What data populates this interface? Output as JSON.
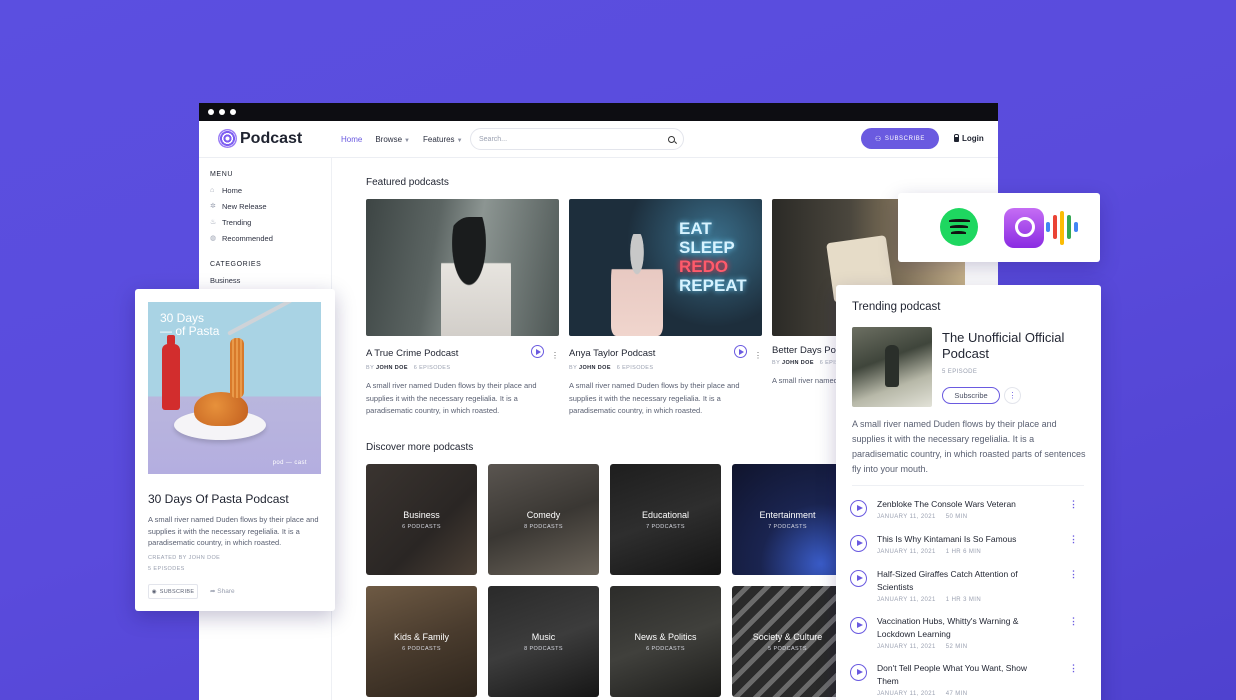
{
  "header": {
    "logo_text": "Podcast",
    "nav": [
      {
        "label": "Home"
      },
      {
        "label": "Browse"
      },
      {
        "label": "Features"
      }
    ],
    "search_placeholder": "Search...",
    "subscribe_label": "SUBSCRIBE",
    "login_label": "Login"
  },
  "sidebar": {
    "menu_heading": "MENU",
    "menu_items": [
      "Home",
      "New Release",
      "Trending",
      "Recommended"
    ],
    "categories_heading": "CATEGORIES",
    "categories": [
      "Business"
    ]
  },
  "featured": {
    "title": "Featured podcasts",
    "cards": [
      {
        "title": "A True Crime Podcast",
        "by": "BY",
        "author": "JOHN DOE",
        "episodes": "6 EPISODES",
        "desc": "A small river named Duden flows by their place and supplies it with the necessary regelialia. It is a paradisematic country, in which roasted."
      },
      {
        "title": "Anya Taylor Podcast",
        "by": "BY",
        "author": "JOHN DOE",
        "episodes": "6 EPISODES",
        "desc": "A small river named Duden flows by their place and supplies it with the necessary regelialia. It is a paradisematic country, in which roasted."
      },
      {
        "title": "Better Days Po",
        "by": "BY",
        "author": "JOHN DOE",
        "episodes": "6 EPIS",
        "desc": "A small river named Duden flows by their place and supplies it with the necessary regelialia. It is a paradisematic country, in which roasted."
      }
    ]
  },
  "discover": {
    "title": "Discover more podcasts",
    "tiles": [
      {
        "name": "Business",
        "count": "6 PODCASTS"
      },
      {
        "name": "Comedy",
        "count": "8 PODCASTS"
      },
      {
        "name": "Educational",
        "count": "7 PODCASTS"
      },
      {
        "name": "Entertainment",
        "count": "7 PODCASTS"
      },
      {
        "name": "Kids & Family",
        "count": "6 PODCASTS"
      },
      {
        "name": "Music",
        "count": "8 PODCASTS"
      },
      {
        "name": "News & Politics",
        "count": "6 PODCASTS"
      },
      {
        "name": "Society & Culture",
        "count": "5 PODCASTS"
      }
    ]
  },
  "pasta_card": {
    "art_title": "30 Days\n— of Pasta",
    "art_mark": "pod — cast",
    "title": "30 Days Of Pasta Podcast",
    "desc": "A small river named Duden flows by their place and supplies it with the necessary regelialia. It is a paradisematic country, in which roasted.",
    "created": "CREATED BY JOHN DOE",
    "episodes": "5 EPISODES",
    "subscribe": "SUBSCRIBE",
    "share": "Share"
  },
  "trending": {
    "heading": "Trending podcast",
    "title": "The Unofficial Official Podcast",
    "episodes": "5 EPISODE",
    "subscribe": "Subscribe",
    "desc": "A small river named Duden flows by their place and supplies it with the necessary regelialia. It is a paradisematic country, in which roasted parts of sentences fly into your mouth.",
    "items": [
      {
        "title": "Zenbloke The Console Wars Veteran",
        "date": "JANUARY 11, 2021",
        "duration": "50 MIN"
      },
      {
        "title": "This Is Why Kintamani Is So Famous",
        "date": "JANUARY 11, 2021",
        "duration": "1 HR 6 MIN"
      },
      {
        "title": "Half-Sized Giraffes Catch Attention of Scientists",
        "date": "JANUARY 11, 2021",
        "duration": "1 HR 3 MIN"
      },
      {
        "title": "Vaccination Hubs, Whitty's Warning & Lockdown Learning",
        "date": "JANUARY 11, 2021",
        "duration": "52 MIN"
      },
      {
        "title": "Don't Tell People What You Want, Show Them",
        "date": "JANUARY 11, 2021",
        "duration": "47 MIN"
      }
    ]
  },
  "colors": {
    "accent": "#6a5ae0",
    "background": "#5a4bdc"
  }
}
